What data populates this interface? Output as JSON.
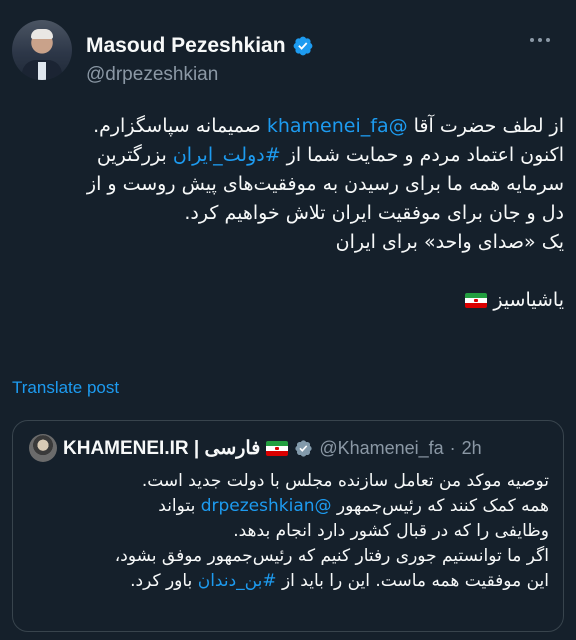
{
  "author": {
    "name": "Masoud Pezeshkian",
    "handle": "@drpezeshkian"
  },
  "post": {
    "lines": [
      [
        {
          "t": "از لطف حضرت آقا "
        },
        {
          "t": "@khamenei_fa",
          "link": true
        },
        {
          "t": " صمیمانه سپاسگزارم."
        }
      ],
      [
        {
          "t": "اکنون اعتماد مردم و حمایت شما از "
        },
        {
          "t": "#دولت_ایران",
          "link": true
        },
        {
          "t": " بزرگترین"
        }
      ],
      [
        {
          "t": "سرمایه همه ما برای رسیدن به موفقیت‌های پیش روست و از"
        }
      ],
      [
        {
          "t": "دل و جان برای موفقیت ایران تلاش خواهیم کرد."
        }
      ],
      [
        {
          "t": "یک «صدای واحد» برای ایران"
        }
      ],
      [],
      [
        {
          "t": "یاشیاسیز "
        },
        {
          "flag": true
        }
      ]
    ]
  },
  "translate_label": "Translate post",
  "quote": {
    "name": "KHAMENEI.IR | فارسی",
    "handle": "@Khamenei_fa",
    "separator": "·",
    "time": "2h",
    "lines": [
      [
        {
          "t": "توصیه موکد من تعامل سازنده مجلس با دولت جدید است."
        }
      ],
      [
        {
          "t": "همه کمک کنند که رئیس‌جمهور "
        },
        {
          "t": "@drpezeshkian",
          "link": true
        },
        {
          "t": " بتواند"
        }
      ],
      [
        {
          "t": "وظایفی را که در قبال کشور دارد انجام بدهد."
        }
      ],
      [
        {
          "t": "اگر ما توانستیم جوری رفتار کنیم که رئیس‌جمهور موفق بشود،"
        }
      ],
      [
        {
          "t": "این موفقیت همه ماست. این را باید از "
        },
        {
          "t": "#بن_دندان",
          "link": true
        },
        {
          "t": " باور کرد."
        }
      ]
    ]
  },
  "colors": {
    "background": "#15202b",
    "text": "#f7f9f9",
    "secondary": "#8b98a5",
    "accent": "#1d9bf0",
    "border": "#38444d"
  },
  "icons": {
    "verified": "verified-badge-icon",
    "more": "more-options-icon",
    "flag": "iran-flag-icon"
  }
}
